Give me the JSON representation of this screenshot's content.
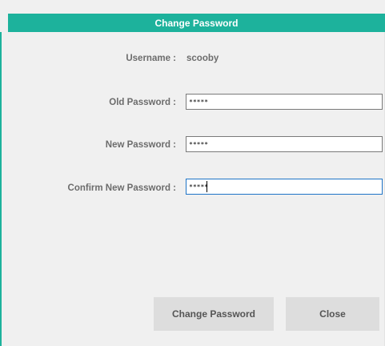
{
  "dialog": {
    "title": "Change Password"
  },
  "form": {
    "username_label": "Username :",
    "username_value": "scooby",
    "old_password_label": "Old Password :",
    "old_password_value": "*****",
    "new_password_label": "New Password :",
    "new_password_value": "*****",
    "confirm_password_label": "Confirm New Password :",
    "confirm_password_value": "*****"
  },
  "buttons": {
    "change_password_label": "Change Password",
    "close_label": "Close"
  },
  "colors": {
    "accent": "#1db29c",
    "background": "#f0f0f0",
    "button": "#dddddd",
    "label_text": "#6c6c6c"
  }
}
